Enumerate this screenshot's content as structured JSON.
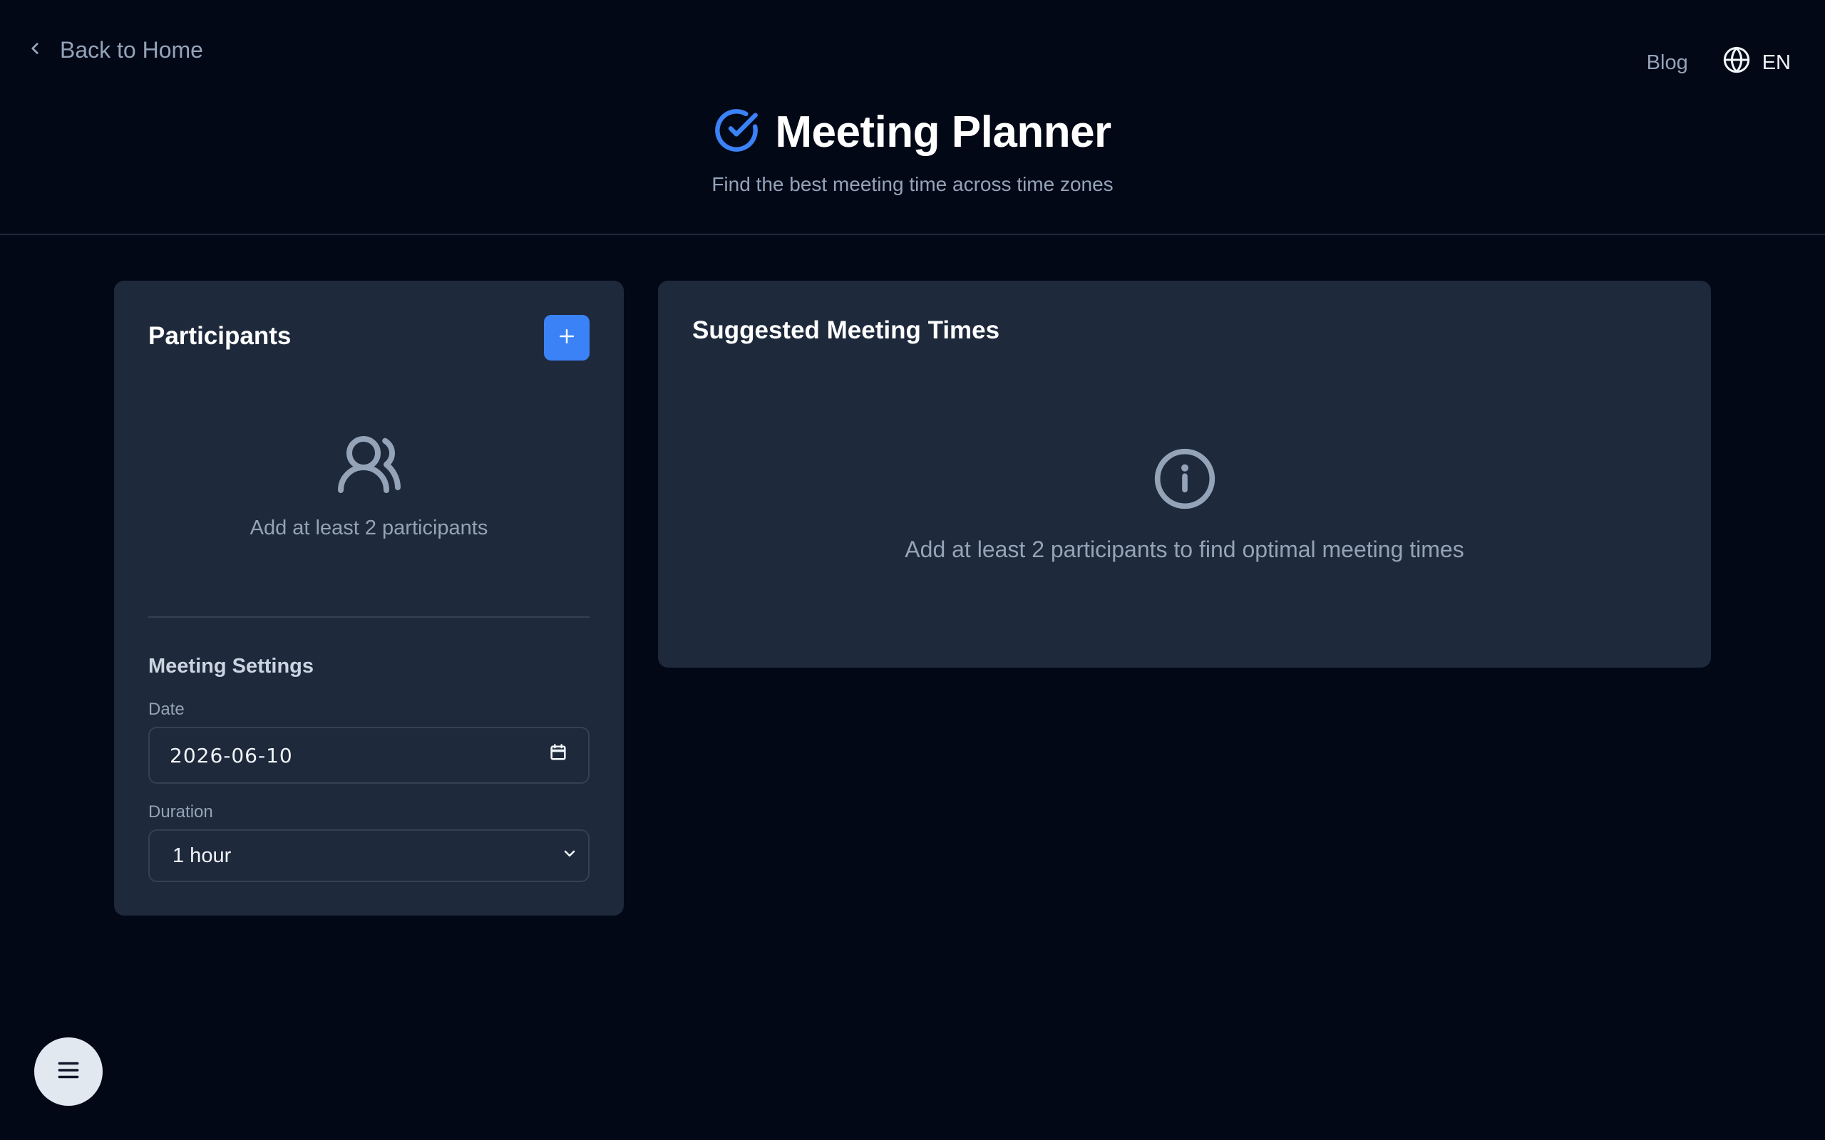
{
  "header": {
    "back_label": "Back to Home",
    "blog_label": "Blog",
    "language_label": "EN",
    "title": "Meeting Planner",
    "subtitle": "Find the best meeting time across time zones"
  },
  "participants": {
    "title": "Participants",
    "empty_text": "Add at least 2 participants"
  },
  "settings": {
    "heading": "Meeting Settings",
    "date_label": "Date",
    "date_value": "2026-06-10",
    "duration_label": "Duration",
    "duration_value": "1 hour"
  },
  "suggestions": {
    "title": "Suggested Meeting Times",
    "empty_text": "Add at least 2 participants to find optimal meeting times"
  },
  "icons": {
    "back": "chevron-left-icon",
    "language": "globe-icon",
    "logo": "check-circle-icon",
    "add": "plus-icon",
    "empty_participants": "users-icon",
    "calendar": "calendar-icon",
    "select": "chevron-down-icon",
    "info": "info-icon",
    "menu": "menu-icon"
  },
  "colors": {
    "background": "#030817",
    "card": "#1e293b",
    "accent": "#3b82f6",
    "muted_text": "#94a3b8"
  }
}
